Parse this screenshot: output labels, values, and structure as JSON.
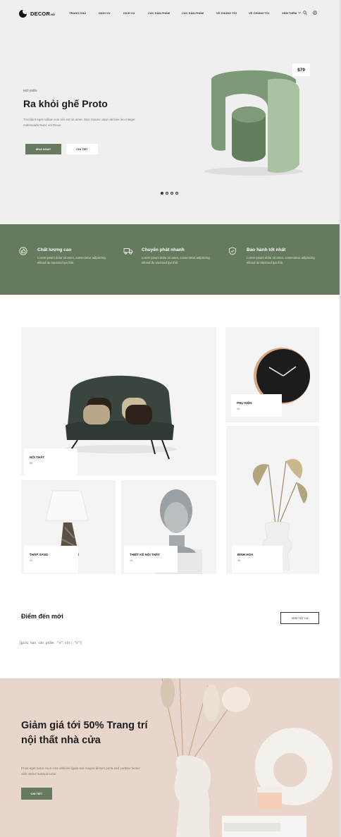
{
  "header": {
    "logo": "DECOR",
    "logo_sub": "HŪ",
    "nav": [
      "TRANG CHỦ",
      "DỊCH VỤ",
      "DỊCH VỤ",
      "CÁC SẢN PHẨM",
      "CÁC SẢN PHẨM",
      "VỀ CHÚNG TÔI",
      "VỀ CHÚNG TÔI",
      "XEM THÊM"
    ],
    "icons": [
      "chevron-down-icon",
      "search-icon",
      "user-icon"
    ]
  },
  "hero": {
    "eyebrow": "MỚI ĐẾN",
    "title": "Ra khỏi ghế Proto",
    "description": "Tincidunt eget nullam non nisi est sit amet. Mus mauris vitae ultricies leo integer malesuada Nunc vel Risus.",
    "primary_button": "MUA NGAY",
    "secondary_button": "CHI TIẾT",
    "price": "$79",
    "slides": 4,
    "active_slide": 1
  },
  "features": [
    {
      "icon": "thumbs-up-icon",
      "title": "Chất lượng cao",
      "desc": "Lorem ipsum dolor sit amet, consectetur adipiscing elitsed do eiusmod tpn thôi."
    },
    {
      "icon": "truck-icon",
      "title": "Chuyển phát nhanh",
      "desc": "Lorem ipsum dolor sit amet, consectetur adipiscing elitsed do eiusmod tpn thôi."
    },
    {
      "icon": "shield-check-icon",
      "title": "Bảo hành tốt nhất",
      "desc": "Lorem ipsum dolor sit amet, consectetur adipiscing elitsed do eiusmod tpn thôi."
    }
  ],
  "categories": [
    {
      "name": "NỘI THẤT",
      "count": "58"
    },
    {
      "name": "PHỤ KIỆN",
      "count": "40"
    },
    {
      "name": "THẮP SÁNG",
      "count": "24"
    },
    {
      "name": "THIẾT KẾ NỘI THẤT",
      "count": "12"
    },
    {
      "name": "BÌNH HOA",
      "count": "36"
    }
  ],
  "new_arrivals": {
    "title": "Điểm đến mới",
    "see_all": "XEM TẤT CẢ",
    "placeholder": "[giới hạn sản phẩm: \"4\" cột: \"4\"]"
  },
  "promo": {
    "title": "Giảm giá tới 50% Trang trí nội thất nhà cửa",
    "description": "Proin eget tortor risus cras ultricies ligula sed magna dictum porta sed porttitor lectus nibh varius suscipit tortor.",
    "button": "CHI TIẾT"
  },
  "colors": {
    "accent": "#667a5d",
    "hero_bg": "#efefef",
    "promo_bg": "#e8d6cc"
  }
}
